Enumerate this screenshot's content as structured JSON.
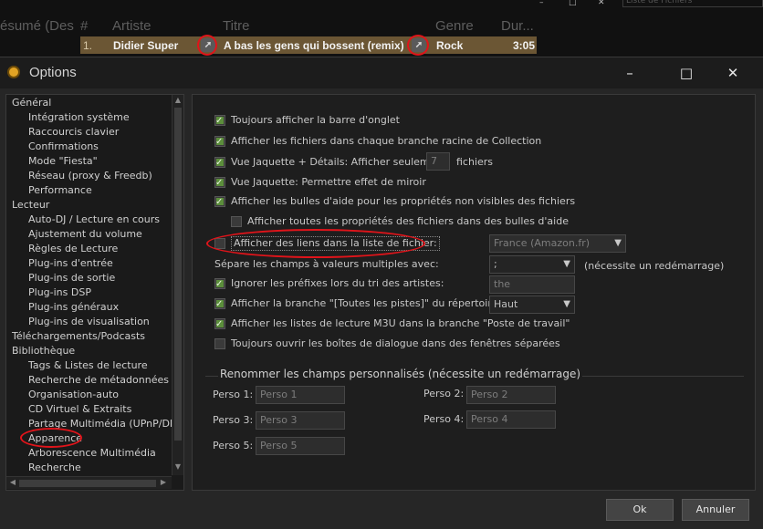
{
  "playlist": {
    "columns": {
      "resume": "ésumé (Des",
      "num": "#",
      "artist": "Artiste",
      "title": "Titre",
      "genre": "Genre",
      "duration": "Dur..."
    },
    "search_placeholder": "Liste de Fichiers",
    "row": {
      "index": "1.",
      "artist": "Didier Super",
      "title": "A bas les gens qui bossent (remix)",
      "genre": "Rock",
      "duration": "3:05"
    }
  },
  "window": {
    "title": "Options",
    "minimize_glyph": "–",
    "maximize_glyph": "□",
    "close_glyph": "✕"
  },
  "sidebar": {
    "items": [
      {
        "label": "Général",
        "level": 1
      },
      {
        "label": "Intégration système",
        "level": 2
      },
      {
        "label": "Raccourcis clavier",
        "level": 2
      },
      {
        "label": "Confirmations",
        "level": 2
      },
      {
        "label": "Mode \"Fiesta\"",
        "level": 2
      },
      {
        "label": "Réseau (proxy & Freedb)",
        "level": 2
      },
      {
        "label": "Performance",
        "level": 2
      },
      {
        "label": "Lecteur",
        "level": 1
      },
      {
        "label": "Auto-DJ / Lecture en cours",
        "level": 2
      },
      {
        "label": "Ajustement du volume",
        "level": 2
      },
      {
        "label": "Règles de Lecture",
        "level": 2
      },
      {
        "label": "Plug-ins d'entrée",
        "level": 2
      },
      {
        "label": "Plug-ins de sortie",
        "level": 2
      },
      {
        "label": "Plug-ins DSP",
        "level": 2
      },
      {
        "label": "Plug-ins généraux",
        "level": 2
      },
      {
        "label": "Plug-ins de visualisation",
        "level": 2
      },
      {
        "label": "Téléchargements/Podcasts",
        "level": 1
      },
      {
        "label": "Bibliothèque",
        "level": 1
      },
      {
        "label": "Tags & Listes de lecture",
        "level": 2
      },
      {
        "label": "Recherche de métadonnées",
        "level": 2
      },
      {
        "label": "Organisation-auto",
        "level": 2
      },
      {
        "label": "CD Virtuel & Extraits",
        "level": 2
      },
      {
        "label": "Partage Multimédia (UPnP/DLNA)",
        "level": 2
      },
      {
        "label": "Apparence",
        "level": 2,
        "selected": true
      },
      {
        "label": "Arborescence Multimédia",
        "level": 2
      },
      {
        "label": "Recherche",
        "level": 2
      }
    ]
  },
  "options": {
    "show_tab_bar": {
      "label": "Toujours afficher la barre d'onglet",
      "checked": true
    },
    "show_files_root": {
      "label": "Afficher les fichiers dans chaque branche racine de Collection",
      "checked": true
    },
    "cover_details": {
      "label": "Vue Jaquette + Détails: Afficher seulement",
      "checked": true,
      "value": "7",
      "suffix": "fichiers"
    },
    "cover_mirror": {
      "label": "Vue Jaquette: Permettre effet de miroir",
      "checked": true
    },
    "tooltips": {
      "label": "Afficher les bulles d'aide pour les propriétés non visibles des fichiers",
      "checked": true
    },
    "all_props_tooltips": {
      "label": "Afficher toutes les propriétés des fichiers dans des bulles d'aide",
      "checked": false
    },
    "file_links": {
      "label": "Afficher des liens dans la liste de fichier:",
      "checked": false,
      "dropdown": "France (Amazon.fr)"
    },
    "multi_value_sep": {
      "label": "Sépare les champs à valeurs multiples avec:",
      "value": ";",
      "note": "(nécessite un redémarrage)"
    },
    "ignore_prefixes": {
      "label": "Ignorer les préfixes lors du tri des artistes:",
      "checked": true,
      "value": "the"
    },
    "all_tracks_branch": {
      "label": "Afficher la branche \"[Toutes les pistes]\" du répertoire en:",
      "checked": true,
      "value": "Haut"
    },
    "m3u_playlists": {
      "label": "Afficher les listes de lecture M3U dans la branche \"Poste de travail\"",
      "checked": true
    },
    "separate_dialogs": {
      "label": "Toujours ouvrir les boîtes de dialogue dans des fenêtres séparées",
      "checked": false
    }
  },
  "custom_fields": {
    "title": "Renommer les champs personnalisés (nécessite un redémarrage)",
    "fields": [
      {
        "label": "Perso 1:",
        "placeholder": "Perso 1"
      },
      {
        "label": "Perso 2:",
        "placeholder": "Perso 2"
      },
      {
        "label": "Perso 3:",
        "placeholder": "Perso 3"
      },
      {
        "label": "Perso 4:",
        "placeholder": "Perso 4"
      },
      {
        "label": "Perso 5:",
        "placeholder": "Perso 5"
      }
    ]
  },
  "buttons": {
    "ok": "Ok",
    "cancel": "Annuler"
  },
  "colors": {
    "highlight_ring": "#e0141a",
    "playing_row": "#6b5634",
    "check_fill": "#5c8f3c"
  }
}
